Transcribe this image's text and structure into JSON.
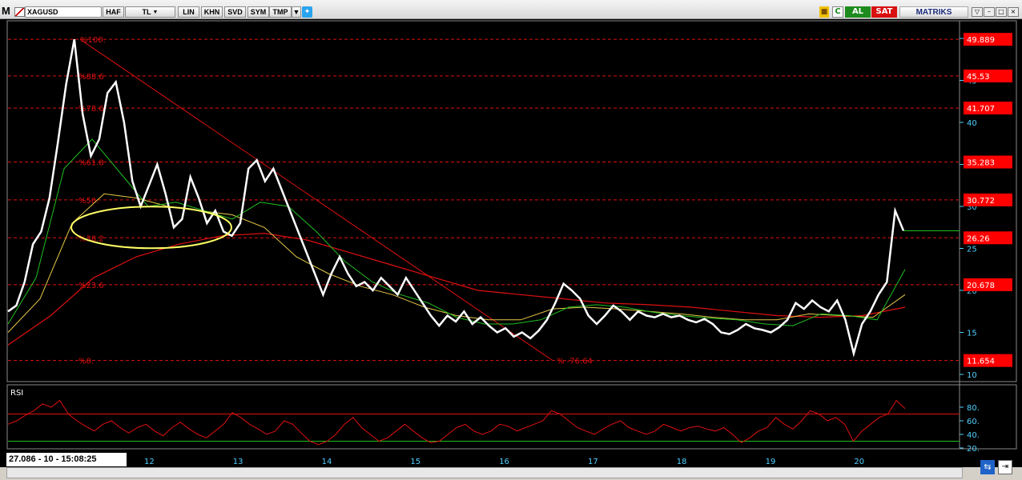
{
  "toolbar": {
    "symbol": "XAGUSD",
    "buttons": [
      "HAF",
      "TL",
      "LIN",
      "KHN",
      "SVD",
      "SYM",
      "TMP"
    ],
    "buy_label": "AL",
    "sell_label": "SAT",
    "brand": "MATRIKS",
    "refresh_label": "C"
  },
  "status": {
    "cursor_readout": "27.086 - 10 - 15:08:25"
  },
  "colors": {
    "background": "#000000",
    "price": "#ffffff",
    "fib_line": "#e01010",
    "ma_short": "#20c020",
    "ma_mid": "#e6c94a",
    "ma_long": "#e01010",
    "axis_text": "#4fd0ff",
    "price_box": "#ff0000",
    "highlight_ellipse": "#ffff66",
    "rsi_line": "#e01010",
    "rsi_upper": "#e01010",
    "rsi_lower": "#20c020",
    "buy": "#1e8b1e",
    "sell": "#d81010"
  },
  "chart_data": [
    {
      "type": "line",
      "name": "price",
      "x_labels": [
        "12",
        "13",
        "14",
        "15",
        "16",
        "17",
        "18",
        "19",
        "20"
      ],
      "y_ticks": [
        10,
        15,
        20,
        25,
        30,
        35,
        40,
        45,
        50
      ],
      "ylim": [
        10,
        50
      ],
      "grid": false,
      "series": [
        {
          "name": "XAGUSD",
          "values": [
            17.5,
            18.2,
            21.0,
            25.5,
            27.0,
            31.0,
            37.5,
            44.5,
            49.9,
            41.0,
            36.0,
            38.0,
            43.5,
            44.8,
            40.0,
            33.0,
            30.0,
            32.5,
            35.0,
            31.5,
            27.5,
            28.5,
            33.5,
            31.0,
            28.0,
            29.5,
            27.0,
            26.5,
            28.0,
            34.5,
            35.5,
            33.0,
            34.5,
            32.0,
            29.5,
            27.0,
            24.5,
            22.0,
            19.5,
            22.0,
            24.0,
            22.0,
            20.5,
            21.0,
            20.0,
            21.5,
            20.5,
            19.5,
            21.5,
            20.0,
            18.5,
            17.0,
            15.8,
            17.0,
            16.3,
            17.5,
            16.0,
            16.8,
            15.8,
            15.0,
            15.5,
            14.5,
            15.0,
            14.3,
            15.2,
            16.5,
            18.5,
            20.8,
            20.0,
            19.0,
            17.0,
            16.0,
            17.0,
            18.2,
            17.5,
            16.5,
            17.5,
            17.0,
            16.8,
            17.2,
            16.8,
            17.0,
            16.5,
            16.2,
            16.6,
            16.0,
            15.0,
            14.8,
            15.3,
            16.0,
            15.5,
            15.3,
            15.0,
            15.6,
            16.5,
            18.5,
            17.8,
            18.8,
            18.0,
            17.5,
            18.8,
            16.5,
            12.5,
            16.0,
            17.5,
            19.5,
            21.0,
            29.5,
            27.1
          ]
        },
        {
          "name": "MA short",
          "values": [
            16.0,
            21.5,
            34.5,
            38.0,
            34.0,
            30.0,
            30.5,
            29.5,
            28.5,
            30.5,
            30.0,
            27.0,
            23.5,
            21.0,
            19.5,
            18.5,
            16.8,
            16.0,
            16.0,
            16.5,
            18.0,
            18.3,
            18.0,
            17.4,
            17.0,
            16.7,
            16.5,
            16.0,
            15.8,
            17.2,
            17.0,
            16.5,
            22.5
          ]
        },
        {
          "name": "MA mid",
          "values": [
            15.0,
            19.0,
            28.0,
            31.5,
            31.0,
            30.0,
            29.5,
            29.0,
            27.5,
            24.0,
            22.0,
            20.5,
            19.5,
            18.0,
            17.0,
            16.5,
            16.5,
            17.8,
            18.0,
            17.8,
            17.5,
            17.2,
            16.8,
            16.5,
            16.5,
            17.2,
            17.0,
            16.8,
            19.5
          ]
        },
        {
          "name": "MA long",
          "values": [
            13.5,
            17.0,
            21.5,
            24.0,
            25.5,
            26.5,
            26.8,
            26.0,
            24.5,
            23.0,
            21.5,
            20.0,
            19.5,
            19.0,
            18.5,
            18.3,
            18.0,
            17.5,
            17.0,
            16.8,
            17.0,
            18.0
          ]
        }
      ],
      "fibonacci": {
        "levels": [
          "%100.",
          "%88.6",
          "%78.6",
          "%61.8",
          "%50.",
          "%38.2",
          "%23.6",
          "%0."
        ],
        "prices": [
          49.889,
          45.53,
          41.707,
          35.283,
          30.772,
          26.26,
          20.678,
          11.654
        ],
        "price_labels": [
          "49.889",
          "45.53",
          "41.707",
          "35.283",
          "30.772",
          "26.26",
          "20.678",
          "11.654"
        ],
        "extension_label": "% -76.64"
      }
    },
    {
      "type": "line",
      "name": "RSI",
      "title": "RSI",
      "y_ticks": [
        20,
        40,
        60,
        80
      ],
      "ylim": [
        20,
        100
      ],
      "upper_band": 70,
      "lower_band": 30,
      "series": [
        {
          "name": "RSI",
          "values": [
            55,
            60,
            68,
            75,
            85,
            80,
            90,
            70,
            60,
            52,
            45,
            55,
            60,
            50,
            42,
            50,
            55,
            45,
            38,
            50,
            58,
            48,
            40,
            35,
            45,
            55,
            72,
            65,
            55,
            48,
            40,
            45,
            60,
            55,
            42,
            30,
            25,
            30,
            40,
            55,
            65,
            50,
            40,
            30,
            35,
            45,
            55,
            45,
            35,
            28,
            30,
            40,
            50,
            55,
            45,
            40,
            45,
            55,
            52,
            45,
            50,
            55,
            60,
            75,
            70,
            60,
            50,
            45,
            40,
            48,
            55,
            60,
            50,
            45,
            40,
            45,
            55,
            50,
            45,
            50,
            52,
            48,
            45,
            50,
            40,
            28,
            35,
            45,
            50,
            65,
            55,
            48,
            60,
            75,
            70,
            60,
            65,
            55,
            30,
            45,
            55,
            65,
            70,
            90,
            78
          ]
        }
      ]
    }
  ]
}
